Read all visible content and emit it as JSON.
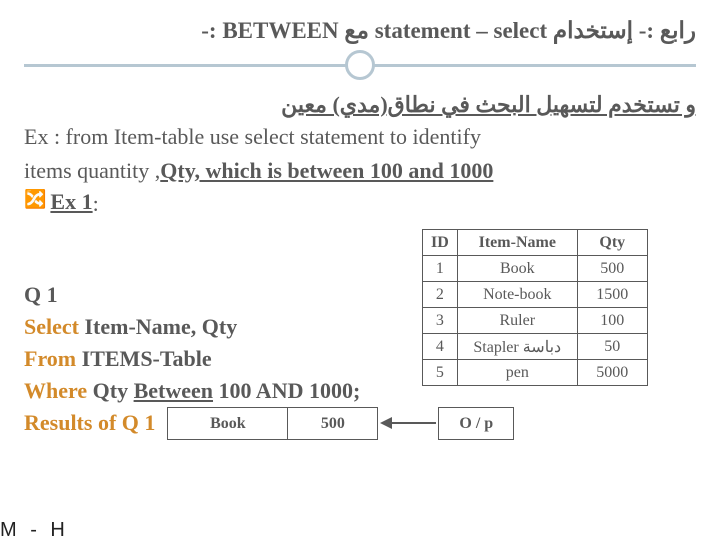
{
  "title": {
    "ar_prefix": "رابع :- إستخدام",
    "en": "statement – select",
    "ar_with": "مع",
    "between": "-: BETWEEN"
  },
  "arabic_note": "و تستخدم لتسهيل البحث في نطاق(مدي) معين",
  "ex_intro_1": "Ex : from Item-table use select statement to identify",
  "ex_intro_2a": "items quantity ,",
  "ex_intro_2b": "Qty, which is between 100 and 1000",
  "ex1_label": "Ex 1",
  "ex1_colon": " :",
  "main_table": {
    "headers": {
      "id": "ID",
      "name": "Item-Name",
      "qty": "Qty"
    },
    "rows": [
      {
        "id": "1",
        "name": "Book",
        "qty": "500"
      },
      {
        "id": "2",
        "name": "Note-book",
        "qty": "1500"
      },
      {
        "id": "3",
        "name": "Ruler",
        "qty": "100"
      },
      {
        "id": "4",
        "name": "Stapler دباسة",
        "qty": "50"
      },
      {
        "id": "5",
        "name": "pen",
        "qty": "5000"
      }
    ]
  },
  "q1": {
    "title": "Q 1",
    "kw_select": "Select",
    "select_rest": " Item-Name, Qty",
    "kw_from": "From",
    "from_rest": " ITEMS-Table",
    "kw_where": "Where",
    "where_qty": " Qty ",
    "kw_between": "Between",
    "where_rest": "  100 AND  1000;",
    "results_label": "Results of Q 1"
  },
  "result_table": {
    "book": "Book",
    "val": "500"
  },
  "op_label": "O / p",
  "footer": "M - H"
}
